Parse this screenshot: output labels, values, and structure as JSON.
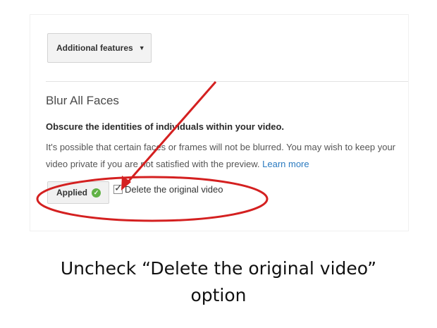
{
  "panel": {
    "features_button": {
      "label": "Additional features",
      "caret": "▼"
    },
    "section_title": "Blur All Faces",
    "description_bold": "Obscure the identities of individuals within your video.",
    "description": "It's possible that certain faces or frames will not be blurred. You may wish to keep your video private if you are not satisfied with the preview.",
    "learn_more": "Learn more",
    "applied_button": {
      "label": "Applied"
    },
    "delete_checkbox": {
      "label": "Delete the original video",
      "checked": true
    }
  },
  "annotation": {
    "color": "#d42020"
  },
  "caption": {
    "line1": "Uncheck “Delete the original video”",
    "line2": "option"
  }
}
